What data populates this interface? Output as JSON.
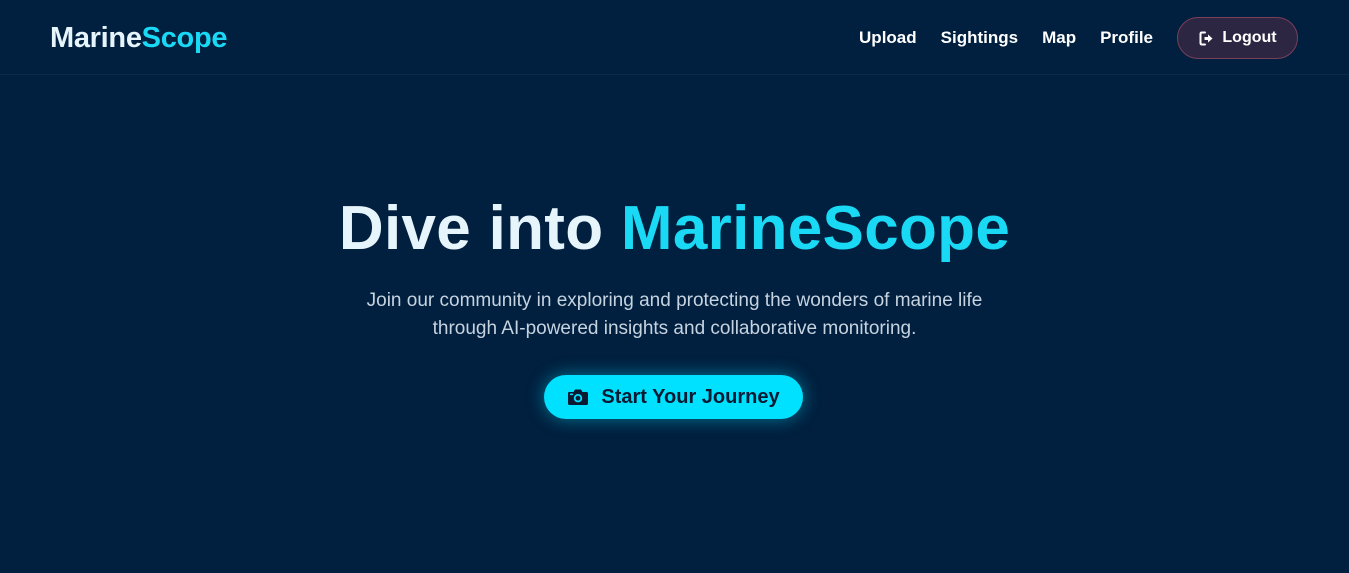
{
  "brand": {
    "part1": "Marine",
    "part2": "Scope"
  },
  "nav": {
    "links": [
      "Upload",
      "Sightings",
      "Map",
      "Profile"
    ],
    "logout_label": "Logout",
    "logout_icon": "logout-icon"
  },
  "hero": {
    "title_part1": "Dive into",
    "title_part2": "MarineScope",
    "subtitle_line1": "Join our community in exploring and protecting the wonders of marine life",
    "subtitle_line2": "through AI-powered insights and collaborative monitoring.",
    "cta_label": "Start Your Journey",
    "cta_icon": "camera-icon"
  },
  "colors": {
    "background": "#011f3e",
    "accent": "#19d9f5",
    "cta_background": "#00e0ff",
    "logout_background": "#2d2642",
    "logout_border": "#7a3f5a"
  }
}
